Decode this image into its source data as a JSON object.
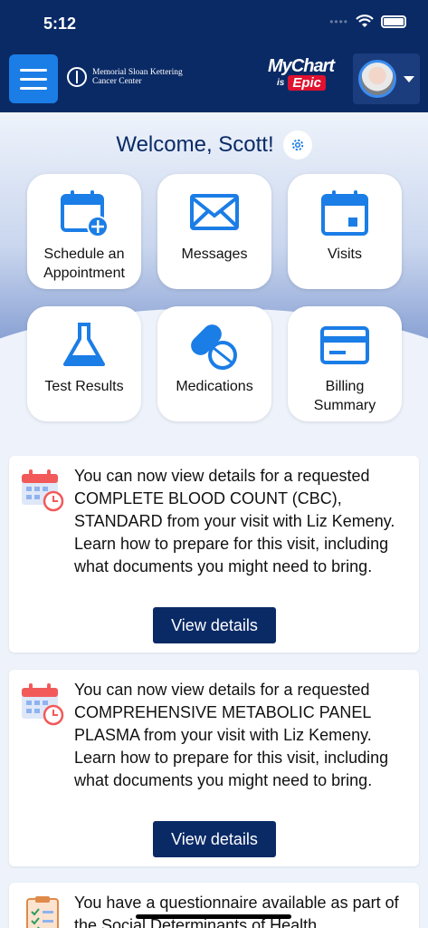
{
  "status_bar": {
    "time": "5:12"
  },
  "header": {
    "org_name": "Memorial Sloan Kettering Cancer Center",
    "brand_mychart": "MyChart",
    "brand_is": "is",
    "brand_epic": "Epic"
  },
  "welcome": {
    "text": "Welcome, Scott!"
  },
  "tiles": [
    {
      "label": "Schedule an Appointment",
      "icon": "calendar-plus-icon"
    },
    {
      "label": "Messages",
      "icon": "envelope-icon"
    },
    {
      "label": "Visits",
      "icon": "calendar-icon"
    },
    {
      "label": "Test Results",
      "icon": "flask-icon"
    },
    {
      "label": "Medications",
      "icon": "pills-icon"
    },
    {
      "label": "Billing Summary",
      "icon": "credit-card-icon"
    }
  ],
  "cards": [
    {
      "text": "You can now view details for a requested COMPLETE BLOOD COUNT (CBC), STANDARD from your visit with Liz Kemeny. Learn how to prepare for this visit, including what documents you might need to bring.",
      "button": "View details"
    },
    {
      "text": "You can now view details for a requested COMPREHENSIVE METABOLIC PANEL PLASMA from your visit with Liz Kemeny. Learn how to prepare for this visit, including what documents you might need to bring.",
      "button": "View details"
    },
    {
      "text": "You have a questionnaire available as part of the Social Determinants of Health"
    }
  ],
  "colors": {
    "navy": "#0a2a66",
    "accent_blue": "#1b7de6",
    "epic_red": "#e0122f"
  }
}
